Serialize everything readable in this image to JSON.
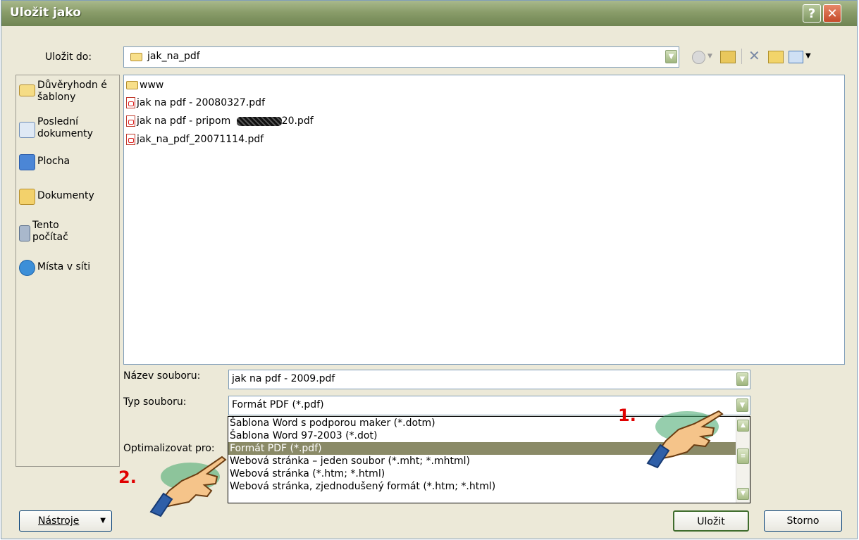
{
  "window": {
    "title": "Uložit jako",
    "help_glyph": "?",
    "close_glyph": "✕"
  },
  "save_in": {
    "label": "Uložit do:",
    "value": "jak_na_pdf"
  },
  "places": [
    {
      "label": "Důvěryhodn é šablony",
      "icon": "trusted-templates-folder-icon"
    },
    {
      "label": "Poslední dokumenty",
      "icon": "recent-documents-icon"
    },
    {
      "label": "Plocha",
      "icon": "desktop-icon"
    },
    {
      "label": "Dokumenty",
      "icon": "documents-icon"
    },
    {
      "label": "Tento počítač",
      "icon": "my-computer-icon"
    },
    {
      "label": "Místa v síti",
      "icon": "network-places-icon"
    }
  ],
  "files": [
    {
      "name": "www",
      "type": "folder"
    },
    {
      "name": "jak na pdf - 20080327.pdf",
      "type": "pdf"
    },
    {
      "name": "jak na pdf - pripom",
      "suffix": "20.pdf",
      "type": "pdf"
    },
    {
      "name": "jak_na_pdf_20071114.pdf",
      "type": "pdf"
    }
  ],
  "filename": {
    "label": "Název souboru:",
    "value": "jak na pdf - 2009.pdf"
  },
  "filetype": {
    "label": "Typ souboru:",
    "value": "Formát PDF (*.pdf)",
    "options": [
      "Šablona Word s podporou maker (*.dotm)",
      "Šablona Word 97-2003 (*.dot)",
      "Formát PDF (*.pdf)",
      "Webová stránka – jeden soubor (*.mht; *.mhtml)",
      "Webová stránka (*.htm; *.html)",
      "Webová stránka, zjednodušený formát (*.htm; *.html)"
    ],
    "selected_index": 2
  },
  "optimize": {
    "label": "Optimalizovat pro:"
  },
  "buttons": {
    "tools": "Nástroje",
    "save": "Uložit",
    "cancel": "Storno"
  },
  "annotations": {
    "step1": "1.",
    "step2": "2."
  },
  "colors": {
    "title_bar": "#8a9d6a",
    "selected_option": "#8a8a67",
    "annotation_red": "#e00000"
  }
}
